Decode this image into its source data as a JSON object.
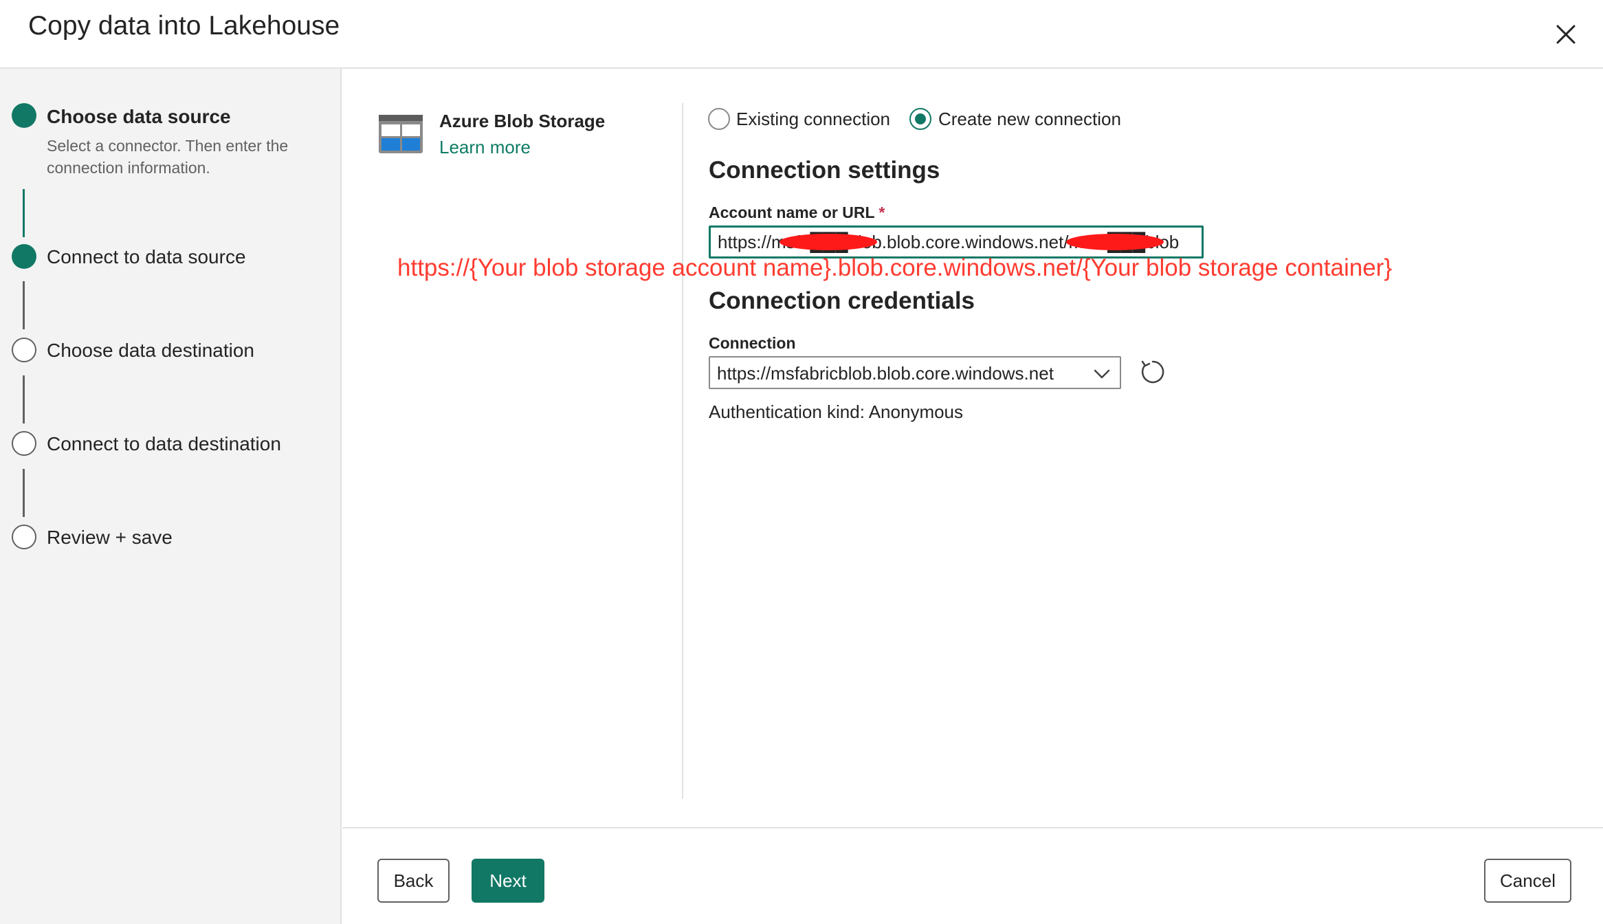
{
  "header": {
    "title": "Copy data into Lakehouse"
  },
  "steps": [
    {
      "label": "Choose data source",
      "description": "Select a connector. Then enter the connection information.",
      "status": "done",
      "active": true
    },
    {
      "label": "Connect to data source",
      "status": "done",
      "active": false
    },
    {
      "label": "Choose data destination",
      "status": "todo",
      "active": false
    },
    {
      "label": "Connect to data destination",
      "status": "todo",
      "active": false
    },
    {
      "label": "Review + save",
      "status": "todo",
      "active": false
    }
  ],
  "connector": {
    "name": "Azure Blob Storage",
    "learn_more": "Learn more",
    "icon": "azure-blob-storage-icon"
  },
  "connection_mode": {
    "existing": "Existing connection",
    "create_new": "Create new connection",
    "selected": "create_new"
  },
  "connection_settings": {
    "title": "Connection settings",
    "account_label": "Account name or URL",
    "required_mark": "*",
    "account_value": "https://msfa███blob.blob.core.windows.net/msfa███blob"
  },
  "annotation": "https://{Your blob storage account name}.blob.core.windows.net/{Your blob storage container}",
  "connection_credentials": {
    "title": "Connection credentials",
    "connection_label": "Connection",
    "connection_value": "https://msfabricblob.blob.core.windows.net",
    "auth_kind": "Authentication kind: Anonymous"
  },
  "footer": {
    "back": "Back",
    "next": "Next",
    "cancel": "Cancel"
  },
  "colors": {
    "accent": "#117865",
    "link": "#0e7c64",
    "annotation": "#ff3b30",
    "redaction": "#ff1a1a",
    "required": "#c4314b"
  }
}
